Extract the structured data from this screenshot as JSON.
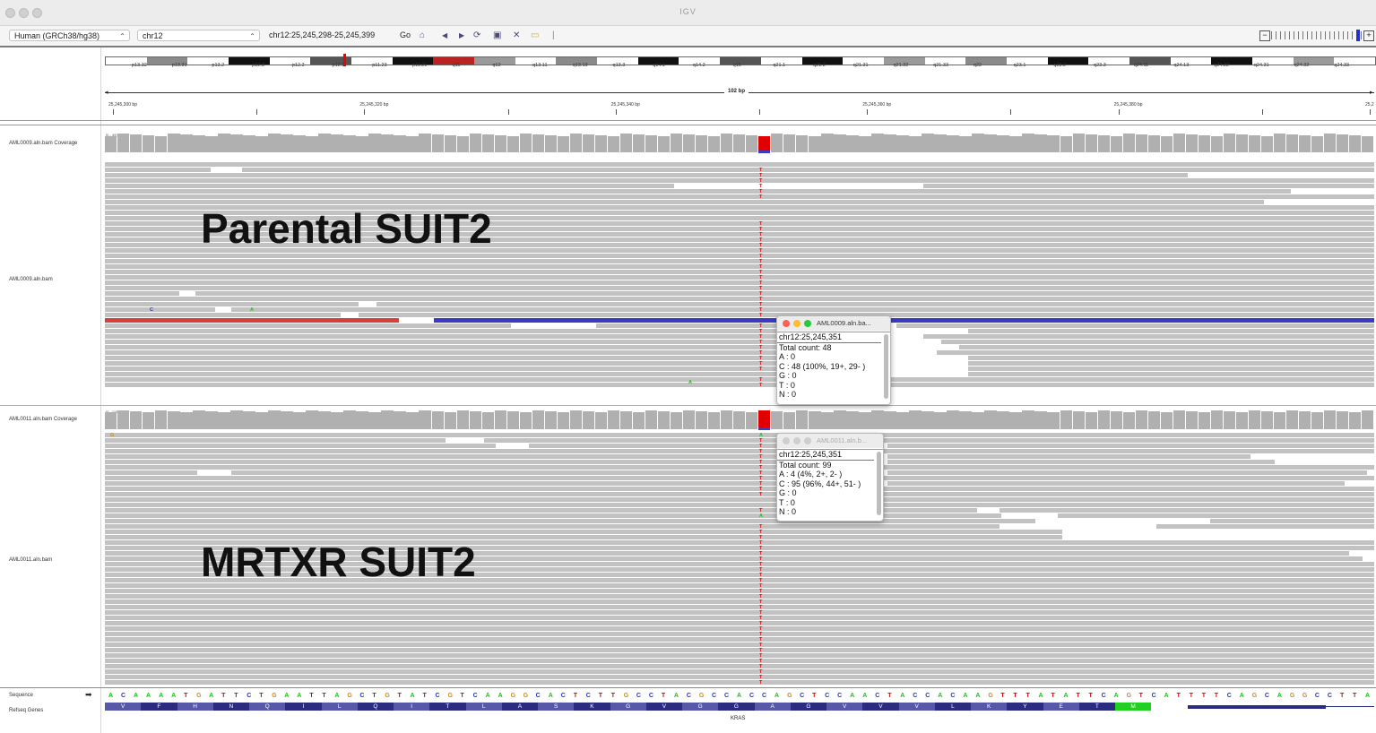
{
  "window": {
    "title": "IGV"
  },
  "toolbar": {
    "genome": "Human (GRCh38/hg38)",
    "chromosome": "chr12",
    "locus": "chr12:25,245,298-25,245,399",
    "go_label": "Go"
  },
  "ideogram": {
    "bands": [
      "p13.32",
      "p13.31",
      "p13.2",
      "p12.3",
      "p12.2",
      "p12.1",
      "p11.23",
      "p11.21",
      "q11",
      "q12",
      "q13.11",
      "q13.13",
      "q13.3",
      "q14.1",
      "q14.2",
      "q15",
      "q21.1",
      "q21.2",
      "q21.31",
      "q21.32",
      "q21.33",
      "q22",
      "q23.1",
      "q23.2",
      "q23.3",
      "q24.11",
      "q24.13",
      "q24.22",
      "q24.31",
      "q24.32",
      "q24.33"
    ]
  },
  "ruler": {
    "span_label": "102 bp",
    "ticks": [
      "25,245,300 bp",
      "25,245,320 bp",
      "25,245,340 bp",
      "25,245,360 bp",
      "25,245,380 bp",
      "25,2"
    ]
  },
  "tracks": {
    "cov1_label": "AML0009.aln.bam Coverage",
    "cov1_range": "[0 - 49]",
    "aln1_label": "AML0009.aln.bam",
    "cov2_label": "AML0011.aln.bam Coverage",
    "cov2_range": "[0 - 110]",
    "aln2_label": "AML0011.aln.bam",
    "seq_label": "Sequence",
    "seq_arrow": "➡",
    "genes_label": "Refseq Genes",
    "gene_name": "KRAS"
  },
  "annotations": {
    "upper": "Parental SUIT2",
    "lower": "MRTXR SUIT2"
  },
  "popups": [
    {
      "title": "AML0009.aln.ba...",
      "lines": [
        "chr12:25,245,351",
        "Total count: 48",
        "A : 0",
        "C : 48 (100%, 19+, 29- )",
        "G : 0",
        "T : 0",
        "N : 0"
      ]
    },
    {
      "title": "AML0011.aln.b...",
      "lines": [
        "chr12:25,245,351",
        "Total count: 99",
        "A : 4 (4%, 2+, 2- )",
        "C : 95 (96%, 44+, 51- )",
        "G : 0",
        "T : 0",
        "N : 0"
      ]
    }
  ],
  "sequence": "ACAAAATGATTCTGAATTAGCTGTATCGTCAAGGCACTCTTGCCTACGCCACCAGCTCCAACTACCACAAGTTTATATTCAGTCATTTTCAGCAGGCCTTA",
  "amino_acids": [
    "V",
    "F",
    "H",
    "N",
    "Q",
    "I",
    "L",
    "Q",
    "I",
    "T",
    "L",
    "A",
    "S",
    "K",
    "G",
    "V",
    "G",
    "G",
    "A",
    "G",
    "V",
    "V",
    "V",
    "L",
    "K",
    "Y",
    "E",
    "T",
    "M"
  ],
  "mismatch_labels": {
    "t": "T",
    "a": "A",
    "c": "C",
    "g": "G"
  },
  "colors": {
    "coverage": "#b0b0b0",
    "coverage_variant": "#e00000",
    "read": "#c2c2c2",
    "read_red": "#d4403a",
    "read_blue": "#3b3ac0",
    "aa_dark": "#2b2b80",
    "aa_light": "#5858a8",
    "start_codon": "#22d022"
  }
}
